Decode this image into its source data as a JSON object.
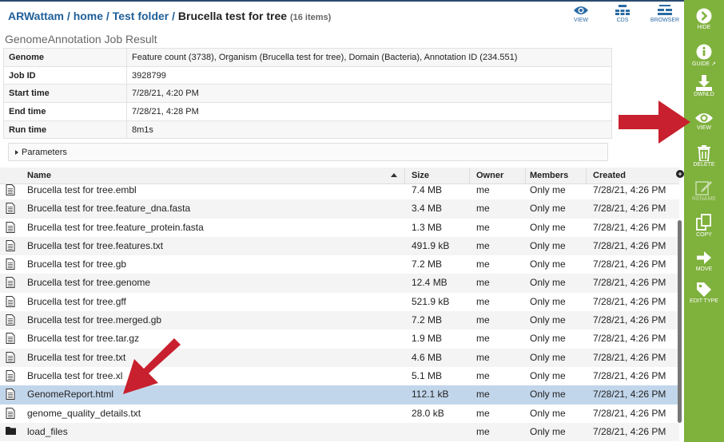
{
  "breadcrumb": {
    "user": "ARWattam",
    "sep": " / ",
    "home": "home",
    "folder": "Test folder",
    "current": "Brucella test for tree",
    "count": "(16 items)"
  },
  "job_title": "GenomeAnnotation Job Result",
  "top_actions": [
    {
      "label": "VIEW",
      "icon": "eye-icon"
    },
    {
      "label": "CDS",
      "icon": "cds-icon"
    },
    {
      "label": "BROWSER",
      "icon": "browser-icon"
    }
  ],
  "meta": [
    {
      "key": "Genome",
      "value": "Feature count (3738), Organism (Brucella test for tree), Domain (Bacteria), Annotation ID (234.551)"
    },
    {
      "key": "Job ID",
      "value": "3928799"
    },
    {
      "key": "Start time",
      "value": "7/28/21, 4:20 PM"
    },
    {
      "key": "End time",
      "value": "7/28/21, 4:28 PM"
    },
    {
      "key": "Run time",
      "value": "8m1s"
    }
  ],
  "parameters_label": "Parameters",
  "columns": {
    "name": "Name",
    "size": "Size",
    "owner": "Owner",
    "members": "Members",
    "created": "Created"
  },
  "files": [
    {
      "name": "Brucella test for tree.embl",
      "size": "7.4 MB",
      "owner": "me",
      "members": "Only me",
      "created": "7/28/21, 4:26 PM",
      "icon": "file-icon"
    },
    {
      "name": "Brucella test for tree.feature_dna.fasta",
      "size": "3.4 MB",
      "owner": "me",
      "members": "Only me",
      "created": "7/28/21, 4:26 PM",
      "icon": "file-icon"
    },
    {
      "name": "Brucella test for tree.feature_protein.fasta",
      "size": "1.3 MB",
      "owner": "me",
      "members": "Only me",
      "created": "7/28/21, 4:26 PM",
      "icon": "file-icon"
    },
    {
      "name": "Brucella test for tree.features.txt",
      "size": "491.9 kB",
      "owner": "me",
      "members": "Only me",
      "created": "7/28/21, 4:26 PM",
      "icon": "file-icon"
    },
    {
      "name": "Brucella test for tree.gb",
      "size": "7.2 MB",
      "owner": "me",
      "members": "Only me",
      "created": "7/28/21, 4:26 PM",
      "icon": "file-icon"
    },
    {
      "name": "Brucella test for tree.genome",
      "size": "12.4 MB",
      "owner": "me",
      "members": "Only me",
      "created": "7/28/21, 4:26 PM",
      "icon": "file-icon"
    },
    {
      "name": "Brucella test for tree.gff",
      "size": "521.9 kB",
      "owner": "me",
      "members": "Only me",
      "created": "7/28/21, 4:26 PM",
      "icon": "file-icon"
    },
    {
      "name": "Brucella test for tree.merged.gb",
      "size": "7.2 MB",
      "owner": "me",
      "members": "Only me",
      "created": "7/28/21, 4:26 PM",
      "icon": "file-icon"
    },
    {
      "name": "Brucella test for tree.tar.gz",
      "size": "1.9 MB",
      "owner": "me",
      "members": "Only me",
      "created": "7/28/21, 4:26 PM",
      "icon": "file-icon"
    },
    {
      "name": "Brucella test for tree.txt",
      "size": "4.6 MB",
      "owner": "me",
      "members": "Only me",
      "created": "7/28/21, 4:26 PM",
      "icon": "file-icon"
    },
    {
      "name": "Brucella test for tree.xl",
      "size": "5.1 MB",
      "owner": "me",
      "members": "Only me",
      "created": "7/28/21, 4:26 PM",
      "icon": "file-icon"
    },
    {
      "name": "GenomeReport.html",
      "size": "112.1 kB",
      "owner": "me",
      "members": "Only me",
      "created": "7/28/21, 4:26 PM",
      "icon": "file-icon",
      "selected": true
    },
    {
      "name": "genome_quality_details.txt",
      "size": "28.0 kB",
      "owner": "me",
      "members": "Only me",
      "created": "7/28/21, 4:26 PM",
      "icon": "file-icon"
    },
    {
      "name": "load_files",
      "size": "",
      "owner": "me",
      "members": "Only me",
      "created": "7/28/21, 4:26 PM",
      "icon": "folder-icon"
    }
  ],
  "sidebar": [
    {
      "label": "HIDE",
      "icon": "chevron-right-circle-icon",
      "enabled": true
    },
    {
      "label": "GUIDE",
      "icon": "info-icon",
      "enabled": true
    },
    {
      "label": "DWNLD",
      "icon": "download-icon",
      "enabled": true
    },
    {
      "label": "VIEW",
      "icon": "eye-icon",
      "enabled": true
    },
    {
      "label": "DELETE",
      "icon": "trash-icon",
      "enabled": true
    },
    {
      "label": "RENAME",
      "icon": "pencil-icon",
      "enabled": false
    },
    {
      "label": "COPY",
      "icon": "copy-icon",
      "enabled": true
    },
    {
      "label": "MOVE",
      "icon": "arrow-right-icon",
      "enabled": true
    },
    {
      "label": "EDIT TYPE",
      "icon": "tag-icon",
      "enabled": true
    }
  ],
  "colors": {
    "sidebar": "#7fb13d",
    "selected_row": "#c2d6eb",
    "annotation_arrow": "#c8202e",
    "link": "#1f5f99"
  }
}
